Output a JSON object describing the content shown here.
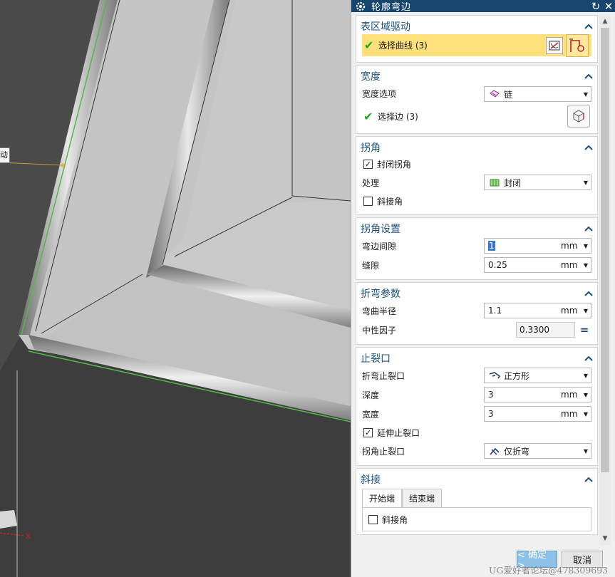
{
  "dialog": {
    "title": "轮廓弯边",
    "ok_label": "< 确定 >",
    "cancel_label": "取消",
    "watermark": "UG爱好者论坛@478309693"
  },
  "viewport": {
    "tag_label": "动",
    "axis_label": "X"
  },
  "surface_drive": {
    "title": "表区域驱动",
    "select_curve_label": "选择曲线 (3)"
  },
  "width": {
    "title": "宽度",
    "option_label": "宽度选项",
    "option_value": "链",
    "select_edge_label": "选择边 (3)"
  },
  "corner": {
    "title": "拐角",
    "close_corner_label": "封闭拐角",
    "close_corner_checked": true,
    "process_label": "处理",
    "process_value": "封闭",
    "miter_label": "斜接角",
    "miter_checked": false
  },
  "corner_settings": {
    "title": "拐角设置",
    "flange_gap_label": "弯边间隙",
    "flange_gap_value": "1",
    "flange_gap_unit": "mm",
    "seam_label": "缝隙",
    "seam_value": "0.25",
    "seam_unit": "mm"
  },
  "bend_params": {
    "title": "折弯参数",
    "radius_label": "弯曲半径",
    "radius_value": "1.1",
    "radius_unit": "mm",
    "k_label": "中性因子",
    "k_value": "0.3300",
    "eq_symbol": "="
  },
  "relief": {
    "title": "止裂口",
    "bend_relief_label": "折弯止裂口",
    "bend_relief_value": "正方形",
    "depth_label": "深度",
    "depth_value": "3",
    "depth_unit": "mm",
    "width_label": "宽度",
    "width_value": "3",
    "width_unit": "mm",
    "extend_label": "延伸止裂口",
    "extend_checked": true,
    "corner_relief_label": "拐角止裂口",
    "corner_relief_value": "仅折弯"
  },
  "miter": {
    "title": "斜接",
    "tab_start": "开始端",
    "tab_end": "结束端",
    "miter_label": "斜接角",
    "miter_checked": false
  }
}
